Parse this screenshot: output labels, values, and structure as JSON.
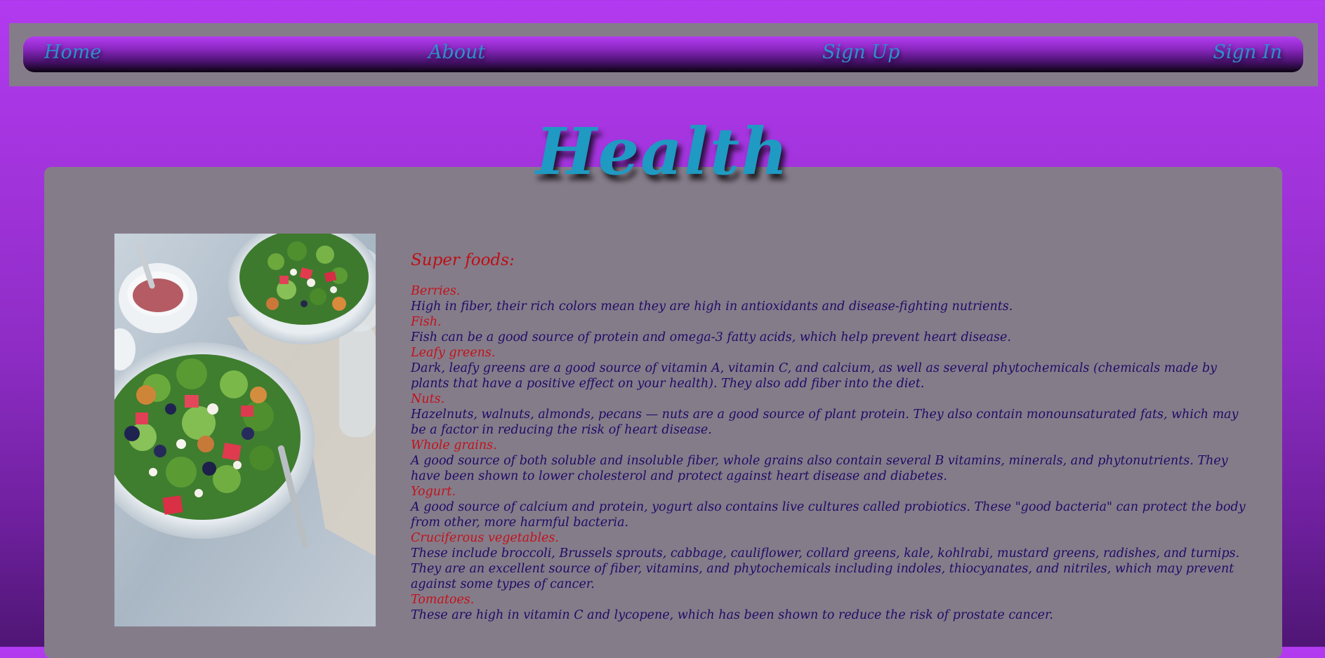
{
  "nav": {
    "items": [
      {
        "label": "Home"
      },
      {
        "label": "About"
      },
      {
        "label": "Sign Up"
      },
      {
        "label": "Sign In"
      }
    ]
  },
  "page": {
    "title": "Health"
  },
  "image": {
    "icon": "salad-photo",
    "alt": ""
  },
  "content": {
    "heading": "Super foods:",
    "foods": [
      {
        "name": "Berries.",
        "desc": "High in fiber, their rich colors mean they are high in antioxidants and disease-fighting nutrients."
      },
      {
        "name": "Fish.",
        "desc": "Fish can be a good source of protein and omega-3 fatty acids, which help prevent heart disease."
      },
      {
        "name": "Leafy greens.",
        "desc": "Dark, leafy greens are a good source of vitamin A, vitamin C, and calcium, as well as several phytochemicals (chemicals made by plants that have a positive effect on your health). They also add fiber into the diet."
      },
      {
        "name": "Nuts.",
        "desc": "Hazelnuts, walnuts, almonds, pecans — nuts are a good source of plant protein. They also contain monounsaturated fats, which may be a factor in reducing the risk of heart disease."
      },
      {
        "name": "Whole grains.",
        "desc": "A good source of both soluble and insoluble fiber, whole grains also contain several B vitamins, minerals, and phytonutrients. They have been shown to lower cholesterol and protect against heart disease and diabetes."
      },
      {
        "name": "Yogurt.",
        "desc": "A good source of calcium and protein, yogurt also contains live cultures called probiotics. These \"good bacteria\" can protect the body from other, more harmful bacteria."
      },
      {
        "name": "Cruciferous vegetables.",
        "desc": "These include broccoli, Brussels sprouts, cabbage, cauliflower, collard greens, kale, kohlrabi, mustard greens, radishes, and turnips. They are an excellent source of fiber, vitamins, and phytochemicals including indoles, thiocyanates, and nitriles, which may prevent against some types of cancer."
      },
      {
        "name": "Tomatoes.",
        "desc": "These are high in vitamin C and lycopene, which has been shown to reduce the risk of prostate cancer."
      }
    ]
  },
  "colors": {
    "background_top": "#b23af0",
    "background_bottom": "#4f1675",
    "panel": "#857c8a",
    "nav_link": "#2d8fd0",
    "title": "#1f9ac2",
    "food_name": "#c3121a",
    "food_desc": "#1e0c66"
  }
}
